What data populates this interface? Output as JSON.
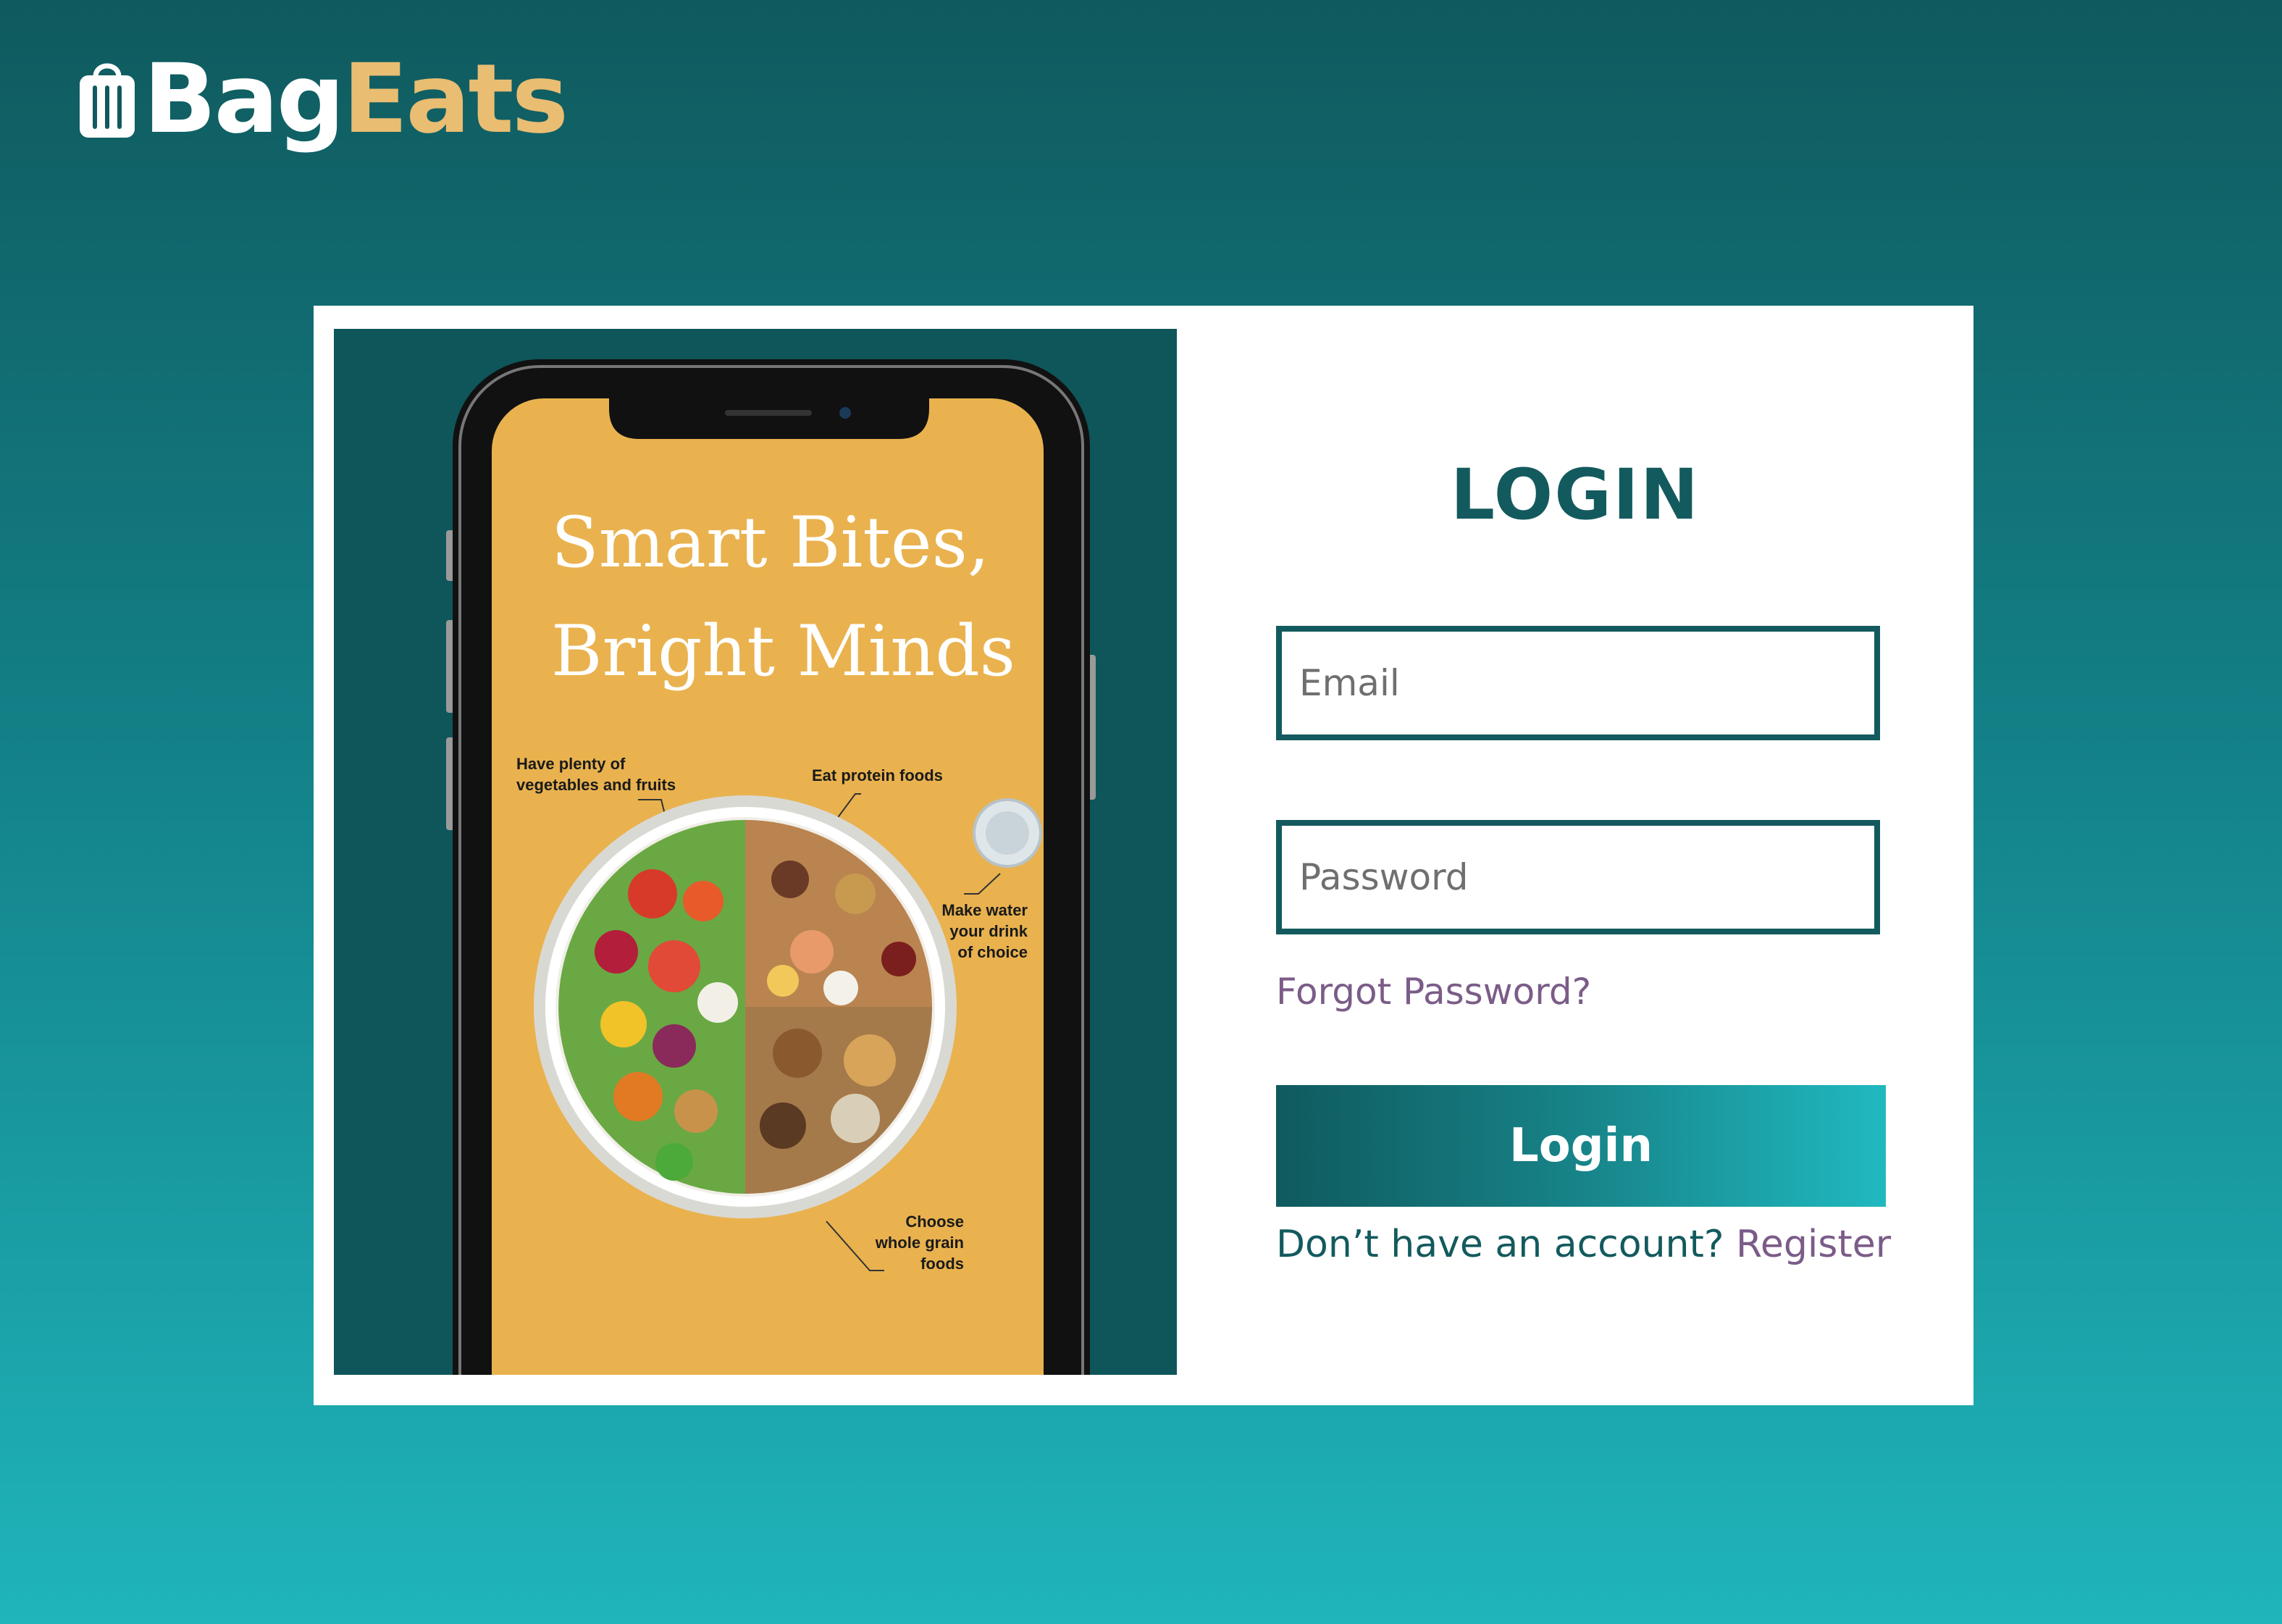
{
  "brand": {
    "name_part1": "Bag",
    "name_part2": "Eats",
    "colors": {
      "primary": "#135a5e",
      "accent": "#e9bd72",
      "link": "#7b5c88"
    }
  },
  "hero": {
    "title_line1": "Smart Bites,",
    "title_line2": "Bright Minds",
    "callouts": {
      "vegetables": "Have plenty of vegetables and fruits",
      "protein": "Eat protein foods",
      "water": "Make water your drink of choice",
      "grains": "Choose whole grain foods"
    }
  },
  "login": {
    "title": "LOGIN",
    "email_placeholder": "Email",
    "password_placeholder": "Password",
    "forgot_label": "Forgot Password?",
    "button_label": "Login",
    "no_account_text": "Don’t have an account?",
    "register_label": "Register"
  }
}
